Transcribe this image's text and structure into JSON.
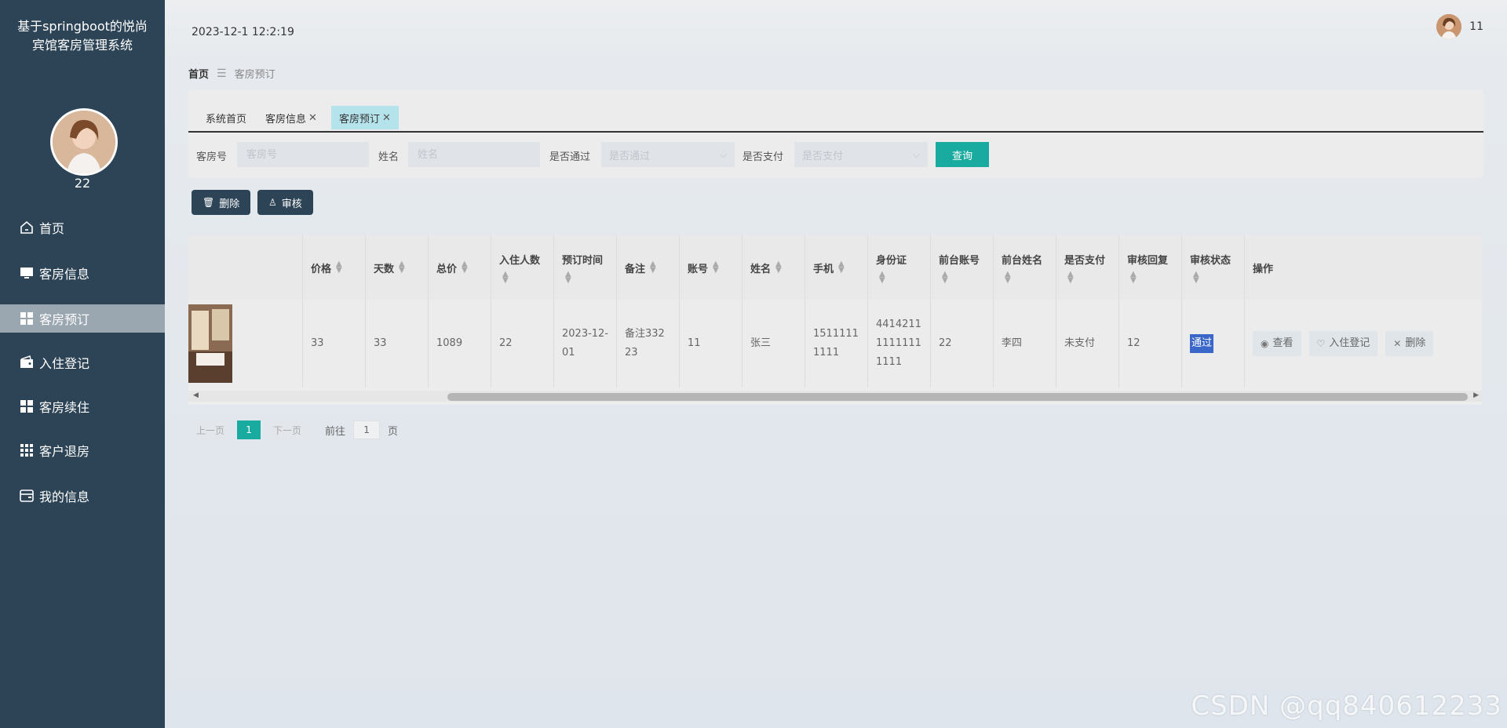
{
  "sidebar": {
    "title": "基于springboot的悦尚宾馆客房管理系统",
    "user_name": "22",
    "menu": [
      {
        "label": "首页",
        "icon": "home-icon"
      },
      {
        "label": "客房信息",
        "icon": "monitor-icon"
      },
      {
        "label": "客房预订",
        "icon": "grid-icon",
        "active": true
      },
      {
        "label": "入住登记",
        "icon": "wallet-icon"
      },
      {
        "label": "客房续住",
        "icon": "grid-icon"
      },
      {
        "label": "客户退房",
        "icon": "apps-icon"
      },
      {
        "label": "我的信息",
        "icon": "card-icon"
      }
    ]
  },
  "header": {
    "datetime": "2023-12-1 12:2:19",
    "user": "11"
  },
  "breadcrumb": {
    "home": "首页",
    "current": "客房预订"
  },
  "tabs": [
    {
      "label": "系统首页",
      "closable": false
    },
    {
      "label": "客房信息",
      "closable": true
    },
    {
      "label": "客房预订",
      "closable": true,
      "active": true
    }
  ],
  "search": {
    "room_label": "客房号",
    "room_placeholder": "客房号",
    "name_label": "姓名",
    "name_placeholder": "姓名",
    "pass_label": "是否通过",
    "pass_placeholder": "是否通过",
    "pay_label": "是否支付",
    "pay_placeholder": "是否支付",
    "query_label": "查询"
  },
  "actions": {
    "delete_label": "删除",
    "audit_label": "审核"
  },
  "table": {
    "columns": [
      "价格",
      "天数",
      "总价",
      "入住人数",
      "预订时间",
      "备注",
      "账号",
      "姓名",
      "手机",
      "身份证",
      "前台账号",
      "前台姓名",
      "是否支付",
      "审核回复",
      "审核状态",
      "操作"
    ],
    "row": {
      "price": "33",
      "days": "33",
      "total": "1089",
      "guests": "22",
      "book_time": "2023-12-01",
      "remark": "备注33223",
      "account": "11",
      "name": "张三",
      "phone": "15111111111",
      "id_card": "441421111111111111",
      "front_account": "22",
      "front_name": "李四",
      "paid": "未支付",
      "reply": "12",
      "status": "通过"
    },
    "ops": {
      "view": "查看",
      "checkin": "入住登记",
      "delete": "删除"
    }
  },
  "pagination": {
    "prev": "上一页",
    "current": "1",
    "next": "下一页",
    "goto": "前往",
    "goto_value": "1",
    "unit": "页"
  },
  "watermark": "CSDN @qq840612233",
  "colors": {
    "sidebar": "#2c4456",
    "accent": "#19aaa0",
    "active_tab": "#b5e3ec"
  }
}
